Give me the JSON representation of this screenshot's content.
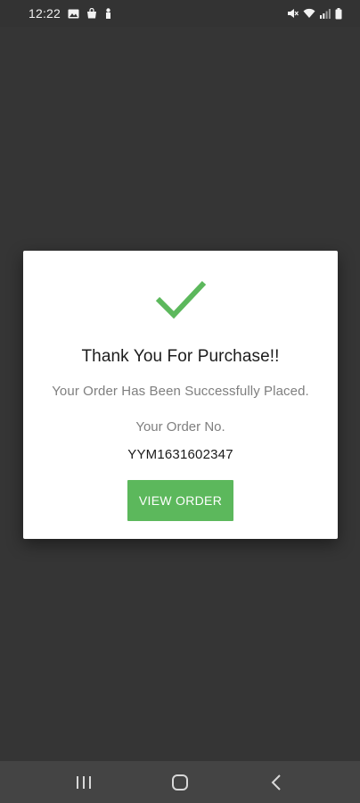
{
  "status_bar": {
    "time": "12:22",
    "left_icons": [
      "gallery-icon",
      "shopping-bag-icon",
      "notification-icon"
    ],
    "right_icons": [
      "mute-icon",
      "wifi-icon",
      "signal-icon",
      "battery-icon"
    ]
  },
  "dialog": {
    "icon": "checkmark-icon",
    "title": "Thank You For Purchase!!",
    "message": "Your Order Has Been Successfully Placed.",
    "order_label": "Your Order No.",
    "order_number": "YYM1631602347",
    "button_label": "VIEW ORDER"
  },
  "nav_bar": {
    "buttons": [
      "recents-icon",
      "home-icon",
      "back-icon"
    ]
  },
  "colors": {
    "accent": "#5cb85c",
    "background": "#353535",
    "status_bar": "#333333",
    "nav_bar": "#444444"
  }
}
